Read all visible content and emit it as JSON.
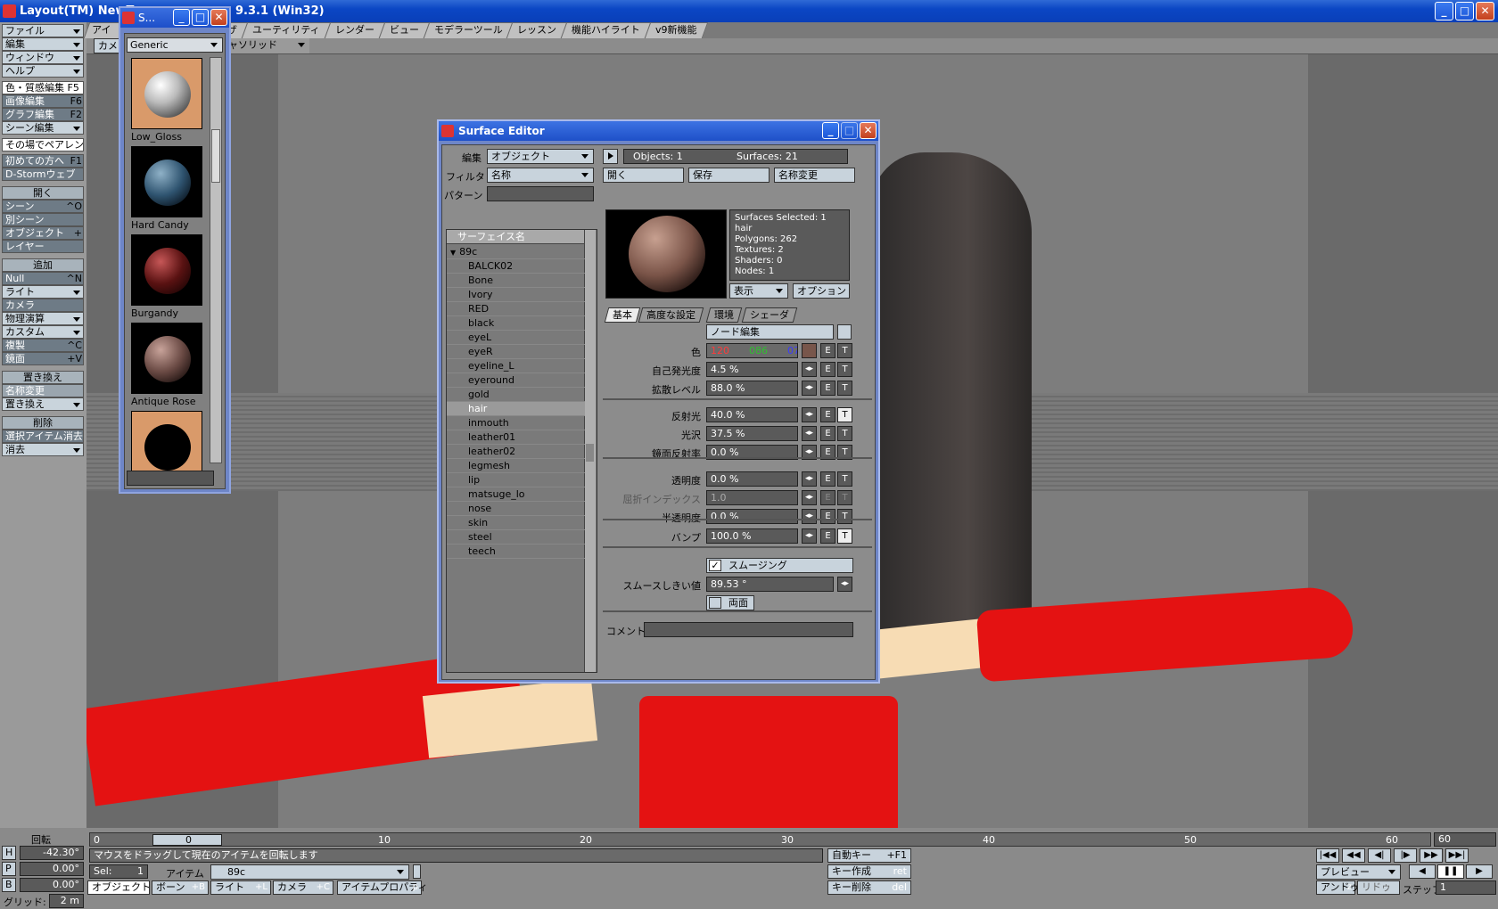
{
  "app": {
    "title": "Layout(TM) NewT... 9.3.1 (Win32)",
    "title_prefix": "Layout(TM) NewT",
    "title_suffix": "9.3.1 (Win32)"
  },
  "window_buttons": {
    "min": "_",
    "max": "□",
    "close": "✕"
  },
  "left_menu": [
    {
      "label": "ファイル",
      "type": "dd"
    },
    {
      "label": "編集",
      "type": "dd"
    },
    {
      "label": "ウィンドウ",
      "type": "dd"
    },
    {
      "label": "ヘルプ",
      "type": "dd"
    },
    {
      "label": "色・質感編集 F5",
      "type": "hl"
    },
    {
      "label": "画像編集",
      "shortcut": "F6"
    },
    {
      "label": "グラフ編集",
      "shortcut": "F2"
    },
    {
      "label": "シーン編集",
      "type": "dd"
    },
    {
      "label": "その場でペアレント",
      "type": "hl"
    },
    {
      "label": "初めての方へ",
      "shortcut": "F1"
    },
    {
      "label": "D-Stormウェブ"
    },
    {
      "label": "開く",
      "type": "hdr"
    },
    {
      "label": "シーン",
      "shortcut": "^O"
    },
    {
      "label": "別シーン"
    },
    {
      "label": "オブジェクト",
      "shortcut": "+"
    },
    {
      "label": "レイヤー"
    },
    {
      "label": "追加",
      "type": "hdr"
    },
    {
      "label": "Null",
      "shortcut": "^N"
    },
    {
      "label": "ライト",
      "type": "dd"
    },
    {
      "label": "カメラ"
    },
    {
      "label": "物理演算",
      "type": "dd"
    },
    {
      "label": "カスタム",
      "type": "dd"
    },
    {
      "label": "複製",
      "shortcut": "^C"
    },
    {
      "label": "鏡面",
      "shortcut": "+V"
    },
    {
      "label": "置き換え",
      "type": "hdr"
    },
    {
      "label": "名称変更",
      "type": "dim"
    },
    {
      "label": "置き換え",
      "type": "dd"
    },
    {
      "label": "削除",
      "type": "hdr"
    },
    {
      "label": "選択アイテム消去"
    },
    {
      "label": "消去",
      "type": "dd"
    }
  ],
  "top_tabs": [
    "アイテ",
    "ザ",
    "ユーティリティ",
    "レンダー",
    "ビュー",
    "モデラーツール",
    "レッスン",
    "機能ハイライト",
    "v9新機能"
  ],
  "toolbar2": {
    "view": "カメ",
    "mode": "ャソリッド"
  },
  "swatch": {
    "title": "S...",
    "preset": "Generic",
    "items": [
      "Low_Gloss",
      "Hard Candy",
      "Burgandy",
      "Antique Rose",
      ""
    ]
  },
  "surface_editor": {
    "title": "Surface Editor",
    "edit_label": "編集",
    "edit_value": "オブジェクト",
    "filter_label": "フィルタ",
    "filter_value": "名称",
    "pattern_label": "パターン",
    "list_header": "サーフェイス名",
    "root": "89c",
    "surfaces": [
      "BALCK02",
      "Bone",
      "Ivory",
      "RED",
      "black",
      "eyeL",
      "eyeR",
      "eyeline_L",
      "eyeround",
      "gold",
      "hair",
      "inmouth",
      "leather01",
      "leather02",
      "legmesh",
      "lip",
      "matsuge_lo",
      "nose",
      "skin",
      "steel",
      "teech"
    ],
    "selected": "hair",
    "objects": "Objects: 1",
    "surfaces_count": "Surfaces: 21",
    "open": "開く",
    "save": "保存",
    "rename": "名称変更",
    "info": [
      "Surfaces Selected: 1",
      "hair",
      "Polygons: 262",
      "Textures: 2",
      "Shaders: 0",
      "Nodes: 1"
    ],
    "display": "表示",
    "options": "オプション",
    "tabs": [
      "基本",
      "高度な設定",
      "環境",
      "シェーダ"
    ],
    "node_edit": "ノード編集",
    "color_label": "色",
    "color_r": "120",
    "color_g": "086",
    "color_b": "075",
    "color_hex": "#78564b",
    "luminosity_label": "自己発光度",
    "luminosity": "4.5 %",
    "diffuse_label": "拡散レベル",
    "diffuse": "88.0 %",
    "specular_label": "反射光",
    "specular": "40.0 %",
    "gloss_label": "光沢",
    "gloss": "37.5 %",
    "reflection_label": "鏡面反射率",
    "reflection": "0.0 %",
    "transparency_label": "透明度",
    "transparency": "0.0 %",
    "refraction_label": "屈折インデックス",
    "refraction": "1.0",
    "translucency_label": "半透明度",
    "translucency": "0.0 %",
    "bump_label": "バンプ",
    "bump": "100.0 %",
    "smoothing": "スムージング",
    "smooth_threshold_label": "スムースしきい値",
    "smooth_threshold": "89.53 °",
    "double_sided": "両面",
    "comment_label": "コメント",
    "e": "E",
    "t": "T"
  },
  "bottom": {
    "rotate": "回転",
    "h_label": "H",
    "h": "-42.30°",
    "p_label": "P",
    "p": "0.00°",
    "b_label": "B",
    "b": "0.00°",
    "grid_label": "グリッド:",
    "grid": "2 m",
    "timeline_start": "0",
    "current_frame": "0",
    "ticks": [
      "10",
      "20",
      "30",
      "40",
      "50",
      "60"
    ],
    "end_frame": "60",
    "status": "マウスをドラッグして現在のアイテムを回転します",
    "sel_label": "Sel:",
    "sel": "1",
    "item_label": "アイテム",
    "item": "89c",
    "objects_btn": "オブジェクト+O",
    "bones_btn": "ボーン",
    "bones_sc": "+B",
    "lights_btn": "ライト",
    "lights_sc": "+L",
    "camera_btn": "カメラ",
    "camera_sc": "+C",
    "item_props": "アイテムプロパティ",
    "item_props_sc": "p",
    "autokey": "自動キー",
    "autokey_sc": "+F1",
    "create_key": "キー作成",
    "create_key_sc": "ret",
    "delete_key": "キー削除",
    "delete_key_sc": "del",
    "preview": "プレビュー",
    "undo": "アンドゥ",
    "undo_sc": "z",
    "redo": "リドゥ",
    "step_label": "ステップ",
    "step": "1"
  }
}
